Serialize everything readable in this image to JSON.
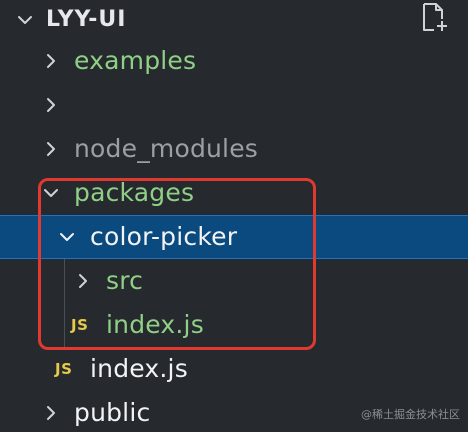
{
  "explorer": {
    "root_title": "LYY-UI",
    "items": [
      {
        "label": "examples",
        "kind": "folder",
        "expanded": false
      },
      {
        "label": "",
        "kind": "folder",
        "expanded": false
      },
      {
        "label": "node_modules",
        "kind": "folder",
        "expanded": false
      },
      {
        "label": "packages",
        "kind": "folder",
        "expanded": true
      },
      {
        "label": "color-picker",
        "kind": "folder",
        "expanded": true,
        "selected": true
      },
      {
        "label": "src",
        "kind": "folder",
        "expanded": false
      },
      {
        "label": "index.js",
        "kind": "file",
        "badge": "JS"
      },
      {
        "label": "index.js",
        "kind": "file",
        "badge": "JS"
      },
      {
        "label": "public",
        "kind": "folder",
        "expanded": false
      }
    ]
  },
  "watermark": {
    "text": "@稀土掘金技术社区"
  },
  "colors": {
    "background": "#262a2e",
    "selection": "#0a4a7f",
    "highlight_border": "#e0392f",
    "green_text": "#8fcf86",
    "js_badge": "#e6c84a"
  },
  "icons": {
    "new_file": "new-file-icon",
    "collapsed": "chevron-right-icon",
    "expanded": "chevron-down-icon"
  }
}
